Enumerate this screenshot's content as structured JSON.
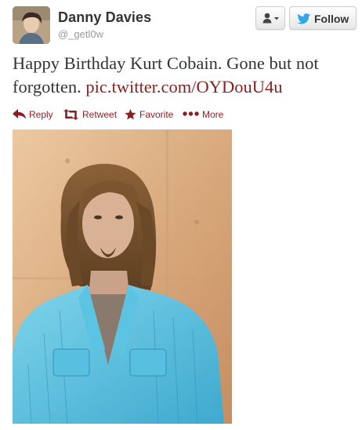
{
  "user": {
    "name": "Danny Davies",
    "handle": "@_getl0w"
  },
  "buttons": {
    "follow_label": "Follow"
  },
  "tweet": {
    "text": "Happy Birthday Kurt Cobain. Gone but not forgotten. ",
    "link": "pic.twitter.com/OYDouU4u"
  },
  "actions": {
    "reply": "Reply",
    "retweet": "Retweet",
    "favorite": "Favorite",
    "more": "More"
  },
  "colors": {
    "accent": "#8b1f1f",
    "twitter_blue": "#2fa8e5",
    "name": "#333333",
    "handle": "#999999"
  },
  "icons": {
    "reply": "reply-arrow-icon",
    "retweet": "retweet-icon",
    "favorite": "star-icon",
    "more": "more-dots-icon",
    "user_menu": "user-dropdown-icon",
    "follow": "twitter-bird-icon"
  }
}
